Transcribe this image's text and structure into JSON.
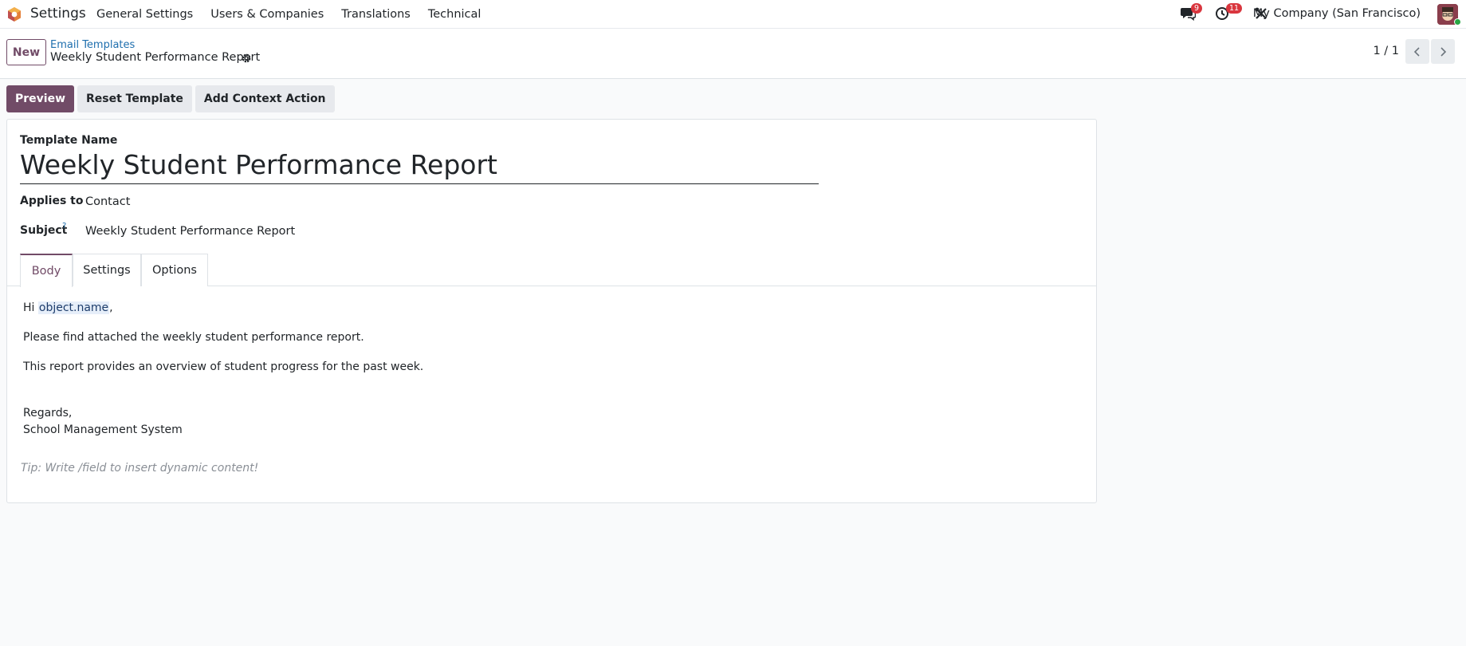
{
  "navbar": {
    "app_name": "Settings",
    "menu": [
      "General Settings",
      "Users & Companies",
      "Translations",
      "Technical"
    ],
    "messages_badge": "9",
    "activities_badge": "11",
    "company": "My Company (San Francisco)"
  },
  "control": {
    "new_label": "New",
    "breadcrumb_parent": "Email Templates",
    "breadcrumb_current": "Weekly Student Performance Report",
    "pager": "1 / 1"
  },
  "statusbar": {
    "preview": "Preview",
    "reset": "Reset Template",
    "add_context": "Add Context Action"
  },
  "form": {
    "template_name_label": "Template Name",
    "template_name": "Weekly Student Performance Report",
    "applies_to_label": "Applies to",
    "applies_to": "Contact",
    "subject_label": "Subject",
    "subject_help": "?",
    "subject": "Weekly Student Performance Report",
    "tabs": [
      "Body",
      "Settings",
      "Options"
    ],
    "body": {
      "greeting_prefix": "Hi ",
      "greeting_field": "object.name",
      "greeting_suffix": ",",
      "line1": "Please find attached the weekly student performance report.",
      "line2": "This report provides an overview of student progress for the past week.",
      "regards": "Regards,",
      "signature": "School Management System"
    },
    "tip": "Tip: Write /field to insert dynamic content!"
  },
  "colors": {
    "brand": "#714b67",
    "link": "#1f6fae",
    "badge": "#d9363e"
  }
}
